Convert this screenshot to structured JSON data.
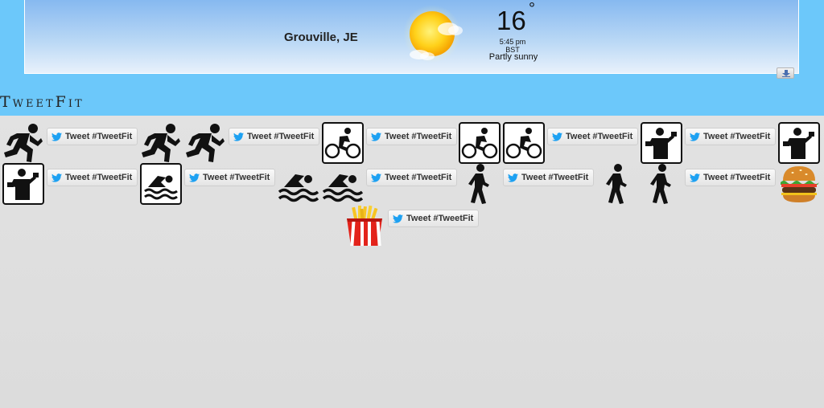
{
  "weather": {
    "location": "Grouville, JE",
    "temperature": "16",
    "degree_symbol": "°",
    "time": "5:45 pm BST",
    "condition": "Partly sunny",
    "icon": "partly-sunny-icon",
    "expand_icon": "download-arrow-icon"
  },
  "app": {
    "title": "TweetFit"
  },
  "tweet_label": "Tweet #TweetFit",
  "items": [
    {
      "icon": "running-icon"
    },
    {
      "icon": "running-icon"
    },
    {
      "icon": "running-icon"
    },
    {
      "icon": "cycling-icon"
    },
    {
      "icon": "cycling-icon"
    },
    {
      "icon": "cycling-icon"
    },
    {
      "icon": "weightlifting-icon"
    },
    {
      "icon": "weightlifting-icon"
    },
    {
      "icon": "weightlifting-icon"
    },
    {
      "icon": "swimming-icon"
    },
    {
      "icon": "swimming-icon"
    },
    {
      "icon": "swimming-icon"
    },
    {
      "icon": "walking-icon"
    },
    {
      "icon": "walking-icon"
    },
    {
      "icon": "walking-icon"
    },
    {
      "icon": "burger-icon"
    },
    {
      "icon": "fries-icon"
    }
  ],
  "colors": {
    "header_background": "#6cc8fa",
    "twitter_blue": "#1da1f2",
    "page_background": "#e0e0e0"
  }
}
